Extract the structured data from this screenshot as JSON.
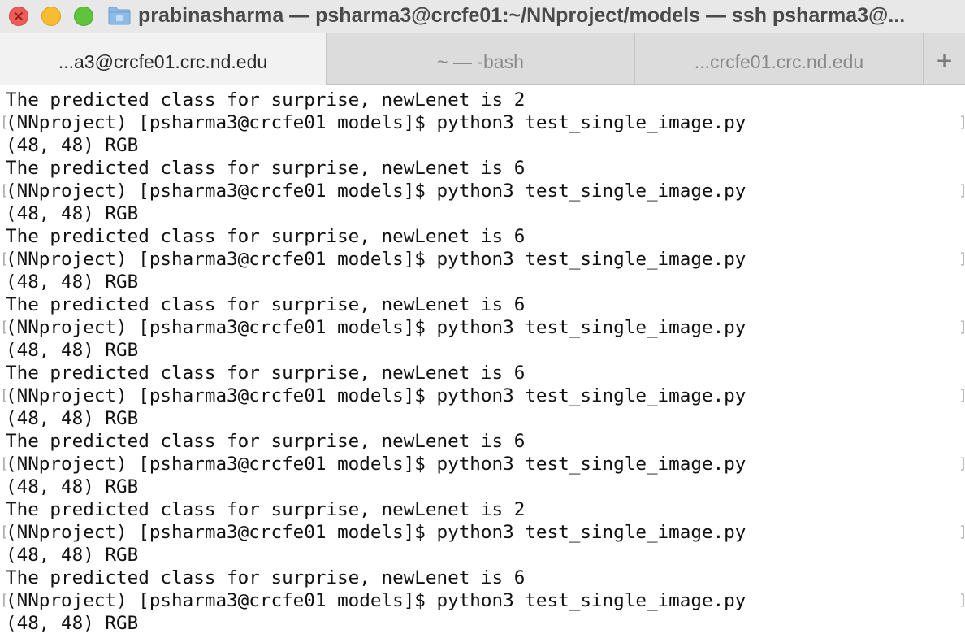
{
  "window": {
    "title": "prabinasharma — psharma3@crcfe01:~/NNproject/models — ssh psharma3@..."
  },
  "tabs": [
    {
      "label": "...a3@crcfe01.crc.nd.edu",
      "active": true
    },
    {
      "label": "~ — -bash",
      "active": false
    },
    {
      "label": "...crcfe01.crc.nd.edu",
      "active": false
    }
  ],
  "new_tab_label": "+",
  "colors": {
    "close": "#ee5c58",
    "minimize": "#f5bd2f",
    "zoom": "#5fc43b",
    "folder": "#7fb2e5"
  },
  "terminal": {
    "lines": [
      {
        "text": "The predicted class for surprise, newLenet is 2",
        "prompt": false
      },
      {
        "text": "(NNproject) [psharma3@crcfe01 models]$ python3 test_single_image.py",
        "prompt": true
      },
      {
        "text": "(48, 48) RGB",
        "prompt": false
      },
      {
        "text": "The predicted class for surprise, newLenet is 6",
        "prompt": false
      },
      {
        "text": "(NNproject) [psharma3@crcfe01 models]$ python3 test_single_image.py",
        "prompt": true
      },
      {
        "text": "(48, 48) RGB",
        "prompt": false
      },
      {
        "text": "The predicted class for surprise, newLenet is 6",
        "prompt": false
      },
      {
        "text": "(NNproject) [psharma3@crcfe01 models]$ python3 test_single_image.py",
        "prompt": true
      },
      {
        "text": "(48, 48) RGB",
        "prompt": false
      },
      {
        "text": "The predicted class for surprise, newLenet is 6",
        "prompt": false
      },
      {
        "text": "(NNproject) [psharma3@crcfe01 models]$ python3 test_single_image.py",
        "prompt": true
      },
      {
        "text": "(48, 48) RGB",
        "prompt": false
      },
      {
        "text": "The predicted class for surprise, newLenet is 6",
        "prompt": false
      },
      {
        "text": "(NNproject) [psharma3@crcfe01 models]$ python3 test_single_image.py",
        "prompt": true
      },
      {
        "text": "(48, 48) RGB",
        "prompt": false
      },
      {
        "text": "The predicted class for surprise, newLenet is 6",
        "prompt": false
      },
      {
        "text": "(NNproject) [psharma3@crcfe01 models]$ python3 test_single_image.py",
        "prompt": true
      },
      {
        "text": "(48, 48) RGB",
        "prompt": false
      },
      {
        "text": "The predicted class for surprise, newLenet is 2",
        "prompt": false
      },
      {
        "text": "(NNproject) [psharma3@crcfe01 models]$ python3 test_single_image.py",
        "prompt": true
      },
      {
        "text": "(48, 48) RGB",
        "prompt": false
      },
      {
        "text": "The predicted class for surprise, newLenet is 6",
        "prompt": false
      },
      {
        "text": "(NNproject) [psharma3@crcfe01 models]$ python3 test_single_image.py",
        "prompt": true
      },
      {
        "text": "(48, 48) RGB",
        "prompt": false
      }
    ]
  }
}
